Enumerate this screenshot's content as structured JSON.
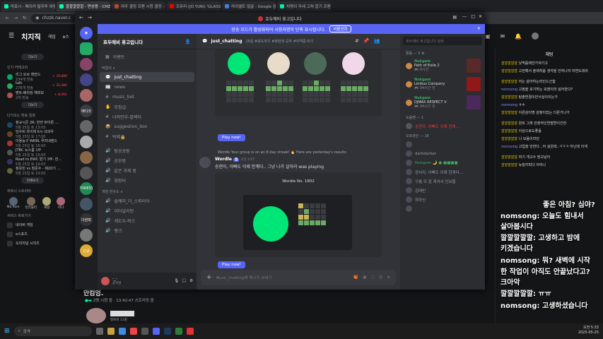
{
  "browser": {
    "tabs": [
      {
        "label": "마표시 - 페이커 탈주투 여명인…"
      },
      {
        "label": "깔깔깔깔깔 - 연승왕 - CHZZK",
        "active": true
      },
      {
        "label": "여주 결정 프랜 시청 결정 - CU"
      },
      {
        "label": "조유리 (JO YURI) 'GLASS'"
      },
      {
        "label": "라이엘트 얼굴 - Google 검색"
      },
      {
        "label": "치명이 자세 고쳐 잡기 프랜 -"
      }
    ],
    "url": "chzzk.naver.c"
  },
  "chzzk": {
    "logo": "치지직",
    "nav": [
      "게임",
      "e스"
    ],
    "more_label": "더보기",
    "popular_category_heading": "인기 카테고리",
    "categories": [
      {
        "name": "리그 오브 레전드",
        "sub": "234개 방송",
        "count": "+ 39,889"
      },
      {
        "name": "talk",
        "sub": "276개 방송",
        "count": "+ 35,480"
      },
      {
        "name": "멘트:배라킹 해피보",
        "sub": "2개 방송",
        "count": "+ 8,361"
      }
    ],
    "upcoming_heading": "다가오는 방송 일정",
    "schedule": [
      {
        "name": "정규시즌 2R: 한전 바이튼 …",
        "date": "5월 25일 토 13:00"
      },
      {
        "name": "당수비 라이테 6시 내과우",
        "date": "5월 25일 토 17:00"
      },
      {
        "name": "이용능구 WKBL 루미네렌드",
        "date": "5월 25일 토 18:00"
      },
      {
        "name": "JTBC 뉴스룸 1부",
        "date": "5월 25일 토 19:00"
      },
      {
        "name": "Road to EWC 뭔기 3주: 한…",
        "date": "5월 25일 토 19:00"
      },
      {
        "name": "정유민 vs 정준수 - 제20기 …",
        "date": "5월 25일 토 19:00"
      }
    ],
    "all_schedule_label": "전체보기",
    "partner_heading": "파트너 스트리머",
    "partners": [
      "NS Rsm",
      "던전블러",
      "해팡",
      "아나"
    ],
    "services_heading": "서비스 바로가기",
    "services": [
      "네이버 게임",
      "e스포츠",
      "오리지널 시리즈"
    ],
    "bottom_text": "안컴엉.",
    "bottom_stats": "2명 시청 중  ·  13:42:47 스트리밍 중",
    "fan_label": "팔로워 11명"
  },
  "discord": {
    "window_title": "호두에비 휴고입니다",
    "banner_text": "방송 모드가 활성화되어 사용자명이 단축 표시됩니다.",
    "banner_button": "비활성화",
    "server_name": "호두에비 휴고입니다",
    "channels_top": [
      {
        "name": "이벤트",
        "icon": "calendar-icon"
      }
    ],
    "category_general": "작업이 ∨",
    "text_channels": [
      {
        "name": "just_chatting",
        "selected": true
      },
      {
        "name": "news"
      },
      {
        "name": "music_bot"
      },
      {
        "name": "모집😊"
      },
      {
        "name": "너의안부-컬렉터"
      },
      {
        "name": "suggestion_box"
      },
      {
        "name": "박제🔒"
      }
    ],
    "voice_channels": [
      "탐공공원",
      "공부방",
      "같은 과제 중",
      "회장터"
    ],
    "category_stream": "게임 연구소 ∨",
    "stream_channels": [
      "숲예미_더_스파이어",
      "이터널리턴",
      "세도우-버스",
      "랭크"
    ],
    "user": {
      "name": "윤서현",
      "status": "-_-"
    },
    "server_labels": [
      "애디크",
      "다원피",
      "FOREST",
      "신규"
    ],
    "main_channel": "just_chatting",
    "topic": "26살 #포도하기 #휴련생 공부 #자격증 따기",
    "messages": [
      {
        "author": "Wordle",
        "badge": "앱",
        "time": "오전 2:07",
        "reply": "Wordle Your group is on an 8 day streak! 🔥 Here are yesterday's results:",
        "text": "승현아, 아빠도 이제 한계다.. 그냥 나가 살아라 was playing",
        "wordle_no": "Wordle No. 1802"
      }
    ],
    "play_label": "Play now!",
    "input_placeholder": "#just_chatting에 메시지 보내기",
    "member_search": "호두에비 휴고입니다 검색",
    "activity_heading": "활동 — 5 ⚙",
    "activities": [
      {
        "user": "Nukgam",
        "game": "Path of Exile 2",
        "time": "🎮 8시간"
      },
      {
        "user": "Nukgam",
        "game": "Limbus Company",
        "time": "🎮 94시간 전"
      },
      {
        "user": "Nukgam",
        "game": "DJMAX RESPECT V",
        "time": "🎮 94시간 전"
      }
    ],
    "online_heading": "도움벤 — 1",
    "online_members": [
      "승현아, 아빠도 이제 한계..."
    ],
    "offline_heading": "오프라인 — 16",
    "offline_members": [
      "",
      "darkdarker",
      "Nukgam 🌙 ● ■■■■",
      "정서자, 아빠도 이제 한계다...",
      "구름 모 잘 계셔서 인보물",
      "김태빈",
      "하하신",
      ""
    ]
  },
  "chat": {
    "title": "채팅",
    "lines": [
      {
        "nick": "깔깔깔깔깔",
        "text": "낮먹음렉만가져가고"
      },
      {
        "nick": "깔깔깔깔깔",
        "text": "고전해서 솔렉처음 생각을 안하니까 자연도데라"
      },
      {
        "nick": "깔깔깔깔깔",
        "text": "저는 살아하는라인드간함"
      },
      {
        "nick": "nomsong",
        "text": "고정을 포기하는 모엔이라 싫어한다?"
      },
      {
        "nick": "깔깔깔깔깔",
        "text": "탐출연결이만사실이이는가"
      },
      {
        "nick": "nomsong",
        "text": "ㅎㅎ"
      },
      {
        "nick": "깔깔깔깔깔",
        "text": "이른삼이명 감정이었는 다른거나가"
      },
      {
        "nick": "깔깔깔깔깔",
        "text": "원트 그래 안정적인연벌연이간헌"
      },
      {
        "nick": "깔깔깔깔깔",
        "text": "이상으로도좋음"
      },
      {
        "nick": "깔깔깔깔깔",
        "text": "나 모음이라던"
      },
      {
        "nick": "nomsong",
        "text": "고업을 안한다...어 싫은데..ㅋㅋㅋ 아닌데 이게"
      },
      {
        "nick": "깔깔깔깔깔",
        "text": "여기 개고수 땅고날어"
      },
      {
        "nick": "깔깔깔깔깔",
        "text": "뉴밀키피다 아마니"
      }
    ]
  },
  "overlay": [
    "좋은 아침? 심야?",
    "nomsong: 오늘도 힘내서",
    "살아봅시다",
    "깔깔깔깔깔: 고생하고 밤에",
    "키겠습니다",
    "nomsong: 뭐? 새벽에 시작",
    "한 작업이 아직도 안끝났다고?",
    "크아악",
    "깔깔깔깔깔: ㅠㅠ",
    "nomsong: 고생하셨습니다"
  ],
  "taskbar": {
    "search": "검색",
    "time": "오전 5:33",
    "date": "2025-05-25"
  }
}
